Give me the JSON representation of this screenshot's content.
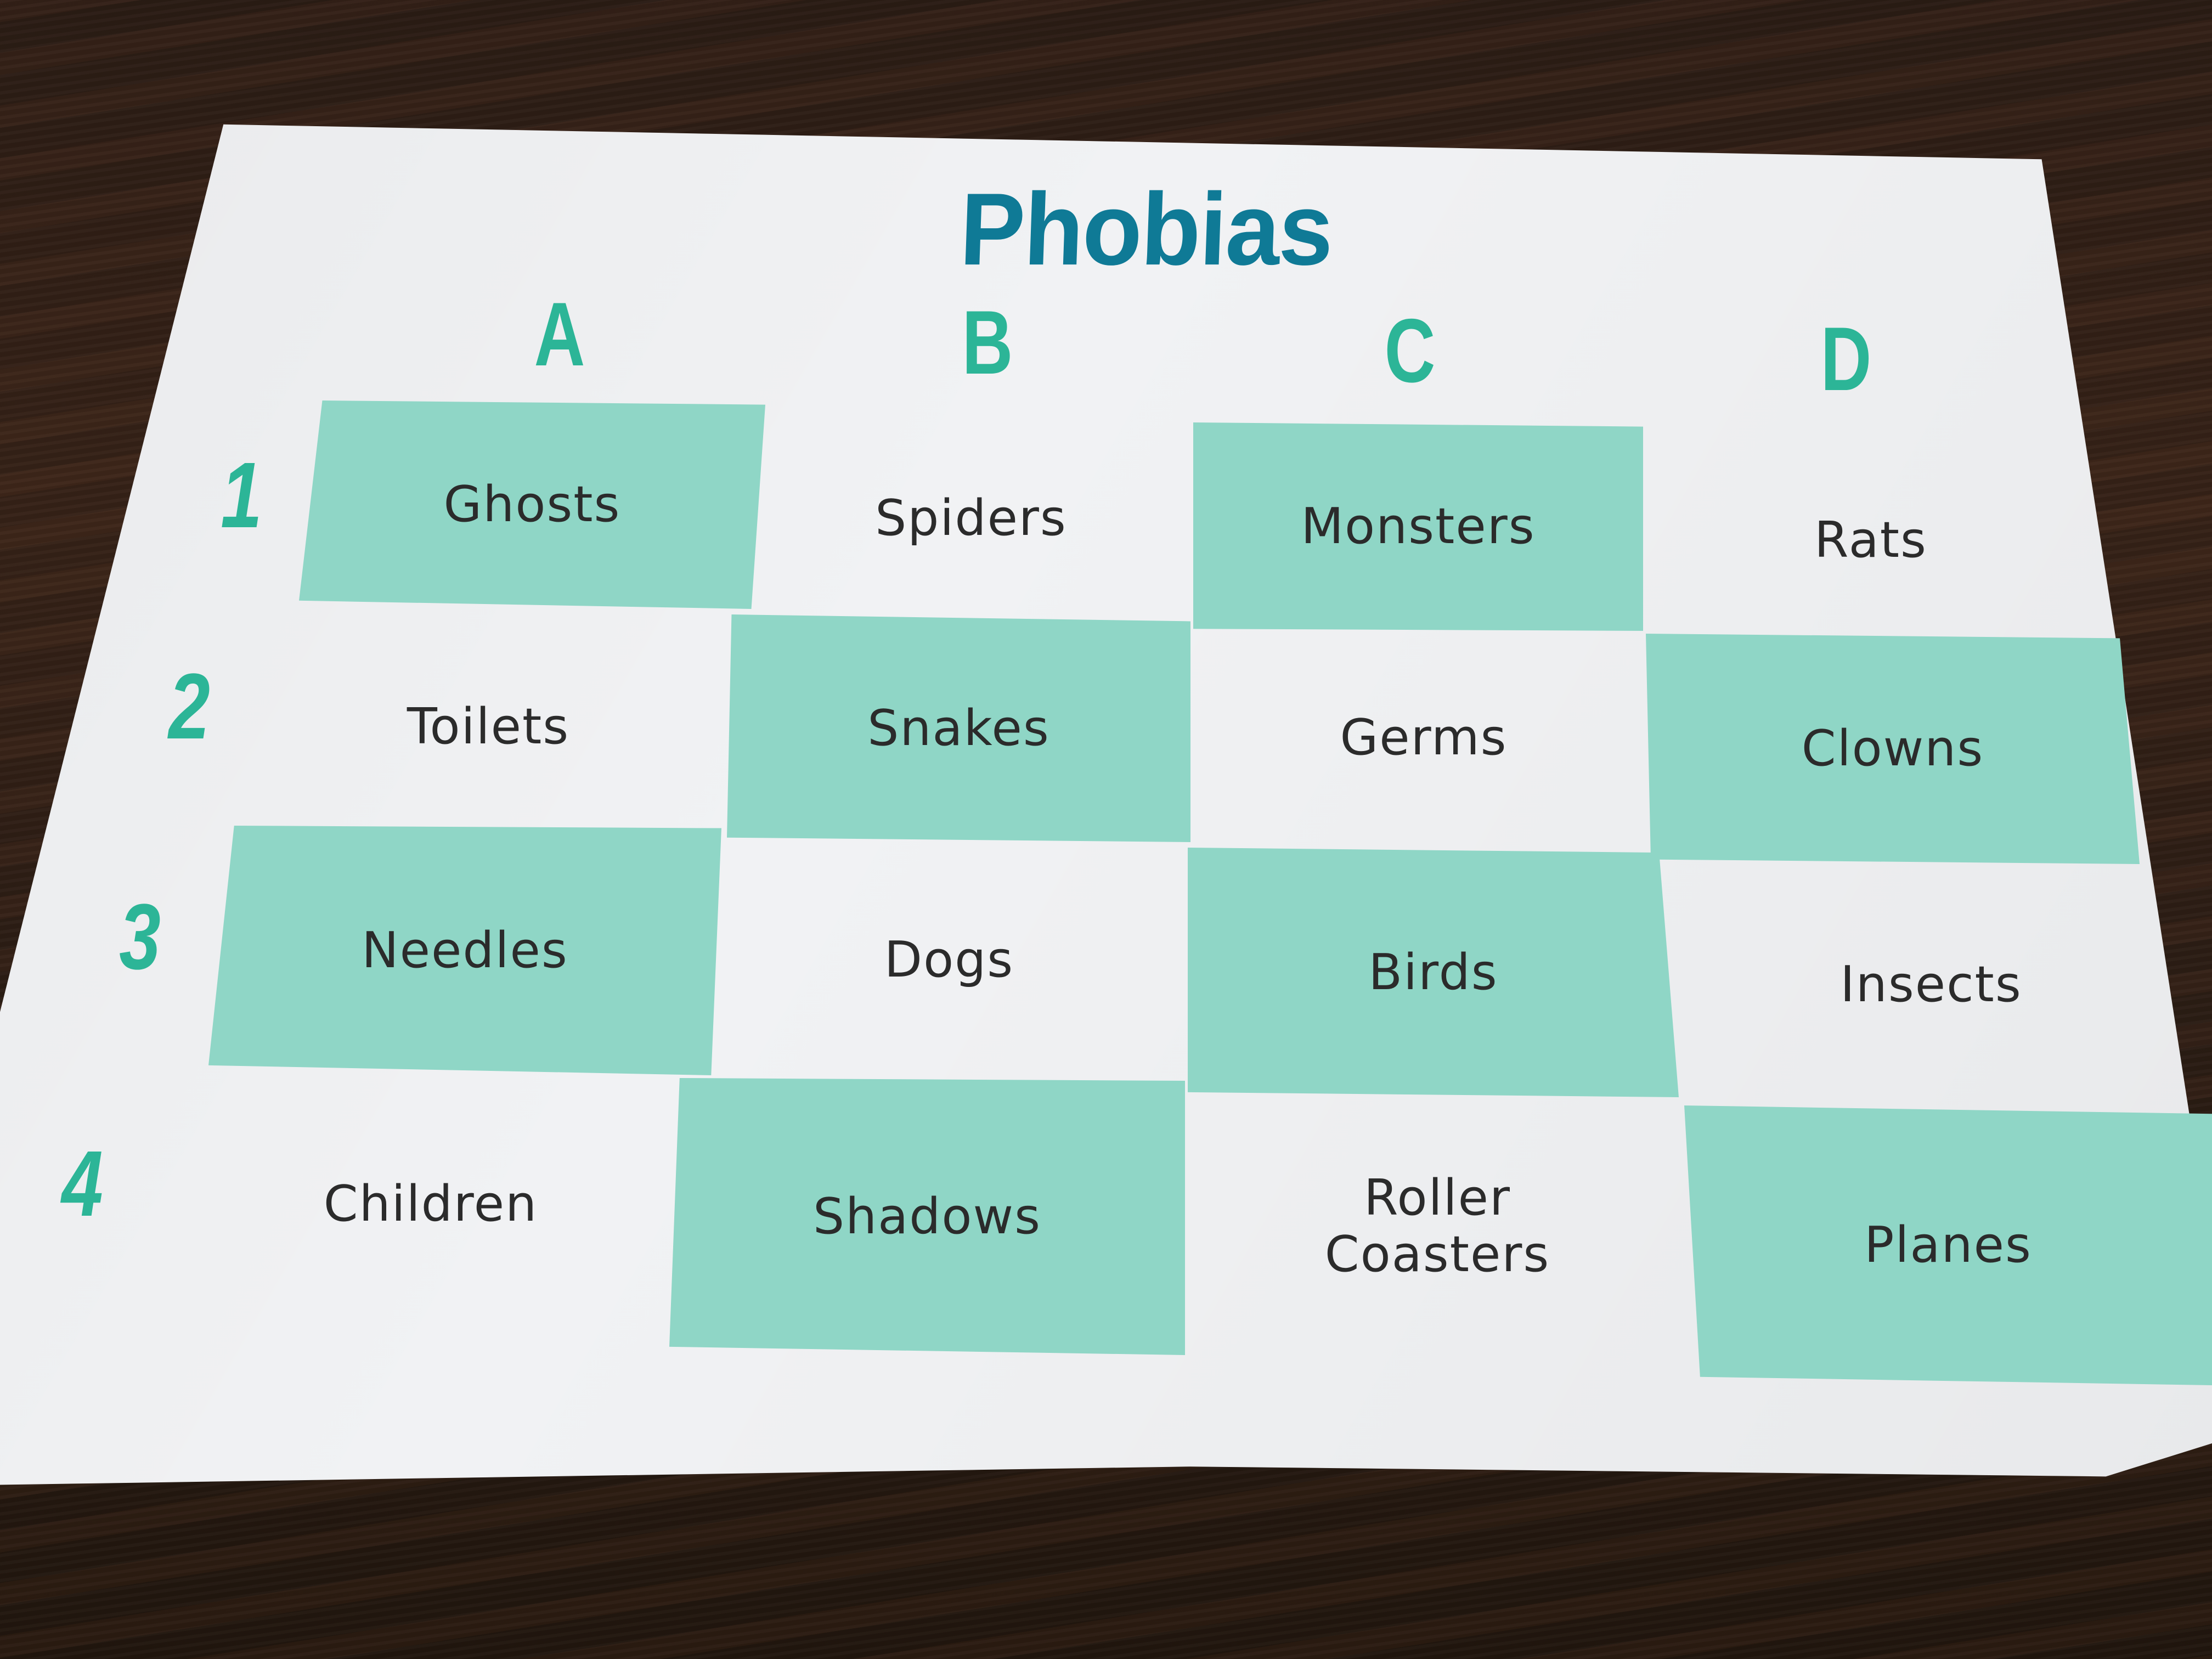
{
  "title": "Phobias",
  "colors": {
    "title": "#0f7a96",
    "header": "#2cb597",
    "teal_cell": "#8fd6c6",
    "card": "#f1f2f4",
    "text": "#2b2b2b"
  },
  "columns": [
    "A",
    "B",
    "C",
    "D"
  ],
  "rows": [
    "1",
    "2",
    "3",
    "4"
  ],
  "grid": [
    [
      "Ghosts",
      "Spiders",
      "Monsters",
      "Rats"
    ],
    [
      "Toilets",
      "Snakes",
      "Germs",
      "Clowns"
    ],
    [
      "Needles",
      "Dogs",
      "Birds",
      "Insects"
    ],
    [
      "Children",
      "Shadows",
      "Roller Coasters",
      "Planes"
    ]
  ]
}
